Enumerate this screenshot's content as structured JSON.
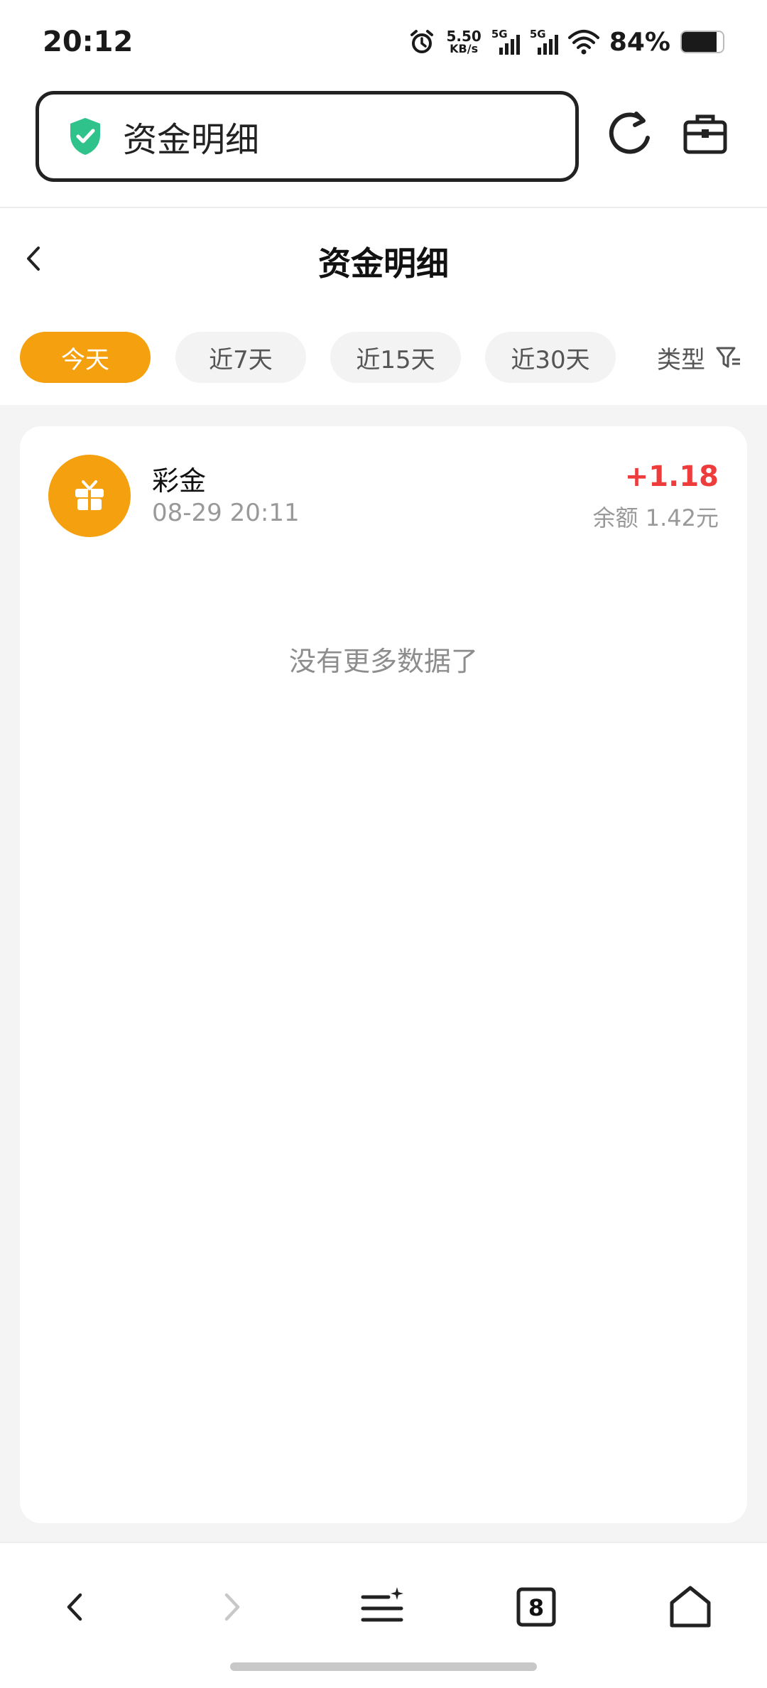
{
  "status_bar": {
    "time": "20:12",
    "net_speed_value": "5.50",
    "net_speed_unit": "KB/s",
    "sim1_label": "5G",
    "sim2_label": "5G",
    "battery_percent": "84%",
    "battery_level": 0.84,
    "icons": [
      "alarm-icon",
      "signal-icon",
      "wifi-icon",
      "battery-icon"
    ]
  },
  "browser": {
    "address_text": "资金明细",
    "secure_icon": "shield-check-icon",
    "refresh_icon": "refresh-icon",
    "toolbox_icon": "toolbox-icon"
  },
  "page": {
    "title": "资金明细",
    "back_icon": "chevron-left-icon"
  },
  "filters": {
    "chips": [
      {
        "label": "今天",
        "active": true
      },
      {
        "label": "近7天",
        "active": false
      },
      {
        "label": "近15天",
        "active": false
      },
      {
        "label": "近30天",
        "active": false
      }
    ],
    "type_label": "类型",
    "type_icon": "filter-icon"
  },
  "records": [
    {
      "icon": "gift-icon",
      "title": "彩金",
      "time": "08-29 20:11",
      "amount": "+1.18",
      "balance": "余额 1.42元"
    }
  ],
  "empty_message": "没有更多数据了",
  "bottom_nav": {
    "items": [
      "back-icon",
      "forward-icon",
      "menu-icon",
      "tabs-icon",
      "home-icon"
    ],
    "tab_count": "8"
  },
  "colors": {
    "accent": "#f5a00f",
    "amount_positive": "#ee3b3b",
    "shield_green": "#2fc38b"
  }
}
